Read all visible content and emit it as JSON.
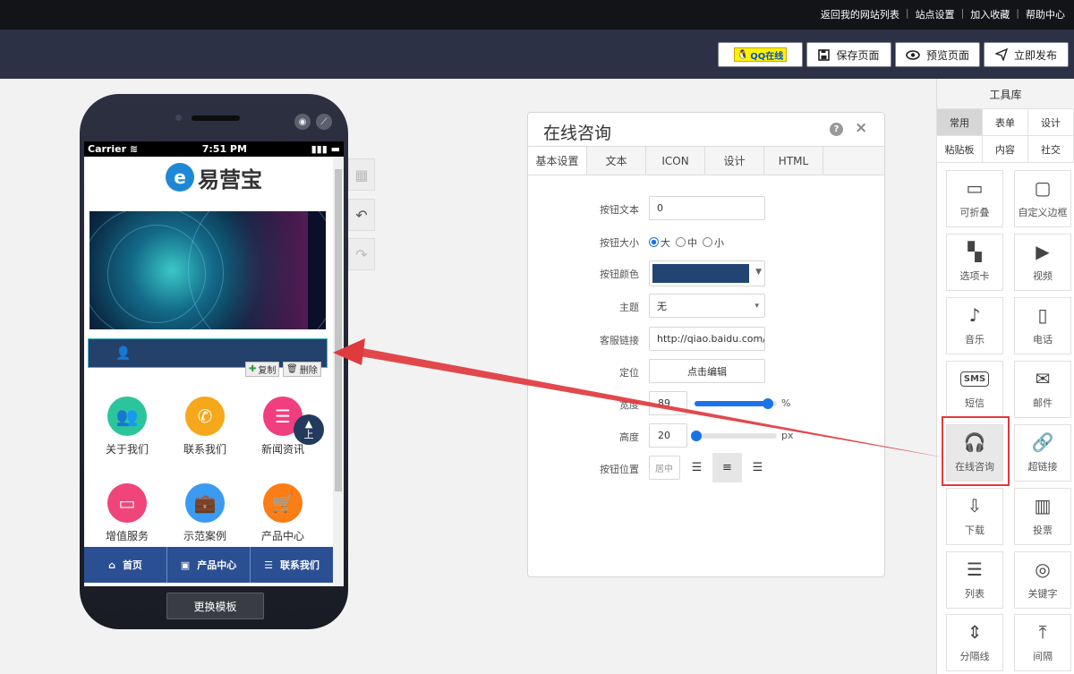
{
  "top_links": [
    "返回我的网站列表",
    "站点设置",
    "加入收藏",
    "帮助中心"
  ],
  "toolbar": {
    "qq_label": "QQ在线",
    "save_label": "保存页面",
    "preview_label": "预览页面",
    "publish_label": "立即发布"
  },
  "phone": {
    "carrier": "Carrier",
    "time": "7:51 PM",
    "logo_mark": "e",
    "logo_text": "易营宝",
    "copy_label": "复制",
    "delete_label": "删除",
    "up_label": "上",
    "grid": [
      {
        "label": "关于我们",
        "color": "#2bc59b"
      },
      {
        "label": "联系我们",
        "color": "#f5a81c"
      },
      {
        "label": "新闻资讯",
        "color": "#f03e7e"
      },
      {
        "label": "增值服务",
        "color": "#f0457a"
      },
      {
        "label": "示范案例",
        "color": "#3a9bf0"
      },
      {
        "label": "产品中心",
        "color": "#fb7d15"
      }
    ],
    "nav": [
      "首页",
      "产品中心",
      "联系我们"
    ],
    "change_template": "更换模板"
  },
  "panel": {
    "title": "在线咨询",
    "tabs": [
      "基本设置",
      "文本",
      "ICON",
      "设计",
      "HTML"
    ],
    "labels": {
      "text": "按钮文本",
      "size": "按钮大小",
      "color": "按钮颜色",
      "theme": "主题",
      "link": "客服链接",
      "position": "定位",
      "width": "宽度",
      "height": "高度",
      "align": "按钮位置"
    },
    "text_value": "0",
    "size_options": [
      "大",
      "中",
      "小"
    ],
    "button_color": "#214472",
    "theme_value": "无",
    "link_value": "http://qiao.baidu.com/?i",
    "position_button": "点击编辑",
    "width_value": "89",
    "width_unit": "%",
    "width_fraction": 0.89,
    "height_value": "20",
    "height_unit": "px",
    "height_fraction": 0.02,
    "align_value": "居中"
  },
  "toolbox": {
    "title": "工具库",
    "categories_row1": [
      "常用",
      "表单",
      "设计"
    ],
    "categories_row2": [
      "粘贴板",
      "内容",
      "社交"
    ],
    "tools": [
      {
        "label": "可折叠",
        "icon": "collapse-icon"
      },
      {
        "label": "自定义边框",
        "icon": "border-icon"
      },
      {
        "label": "选项卡",
        "icon": "tabs-icon"
      },
      {
        "label": "视频",
        "icon": "video-icon"
      },
      {
        "label": "音乐",
        "icon": "music-icon"
      },
      {
        "label": "电话",
        "icon": "phone-icon"
      },
      {
        "label": "短信",
        "icon": "sms-icon"
      },
      {
        "label": "邮件",
        "icon": "mail-icon"
      },
      {
        "label": "在线咨询",
        "icon": "headset-icon"
      },
      {
        "label": "超链接",
        "icon": "link-icon"
      },
      {
        "label": "下载",
        "icon": "download-icon"
      },
      {
        "label": "投票",
        "icon": "vote-icon"
      },
      {
        "label": "列表",
        "icon": "list-icon"
      },
      {
        "label": "关键字",
        "icon": "target-icon"
      },
      {
        "label": "分隔线",
        "icon": "divider-icon"
      },
      {
        "label": "间隔",
        "icon": "spacer-icon"
      }
    ],
    "sms_glyph": "SMS"
  }
}
